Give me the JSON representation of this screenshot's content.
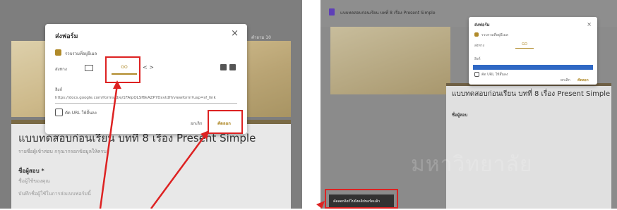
{
  "left": {
    "dialog": {
      "title": "ส่งฟอร์ม",
      "close": "×",
      "collect_emails": "รวบรวมที่อยู่อีเมล",
      "send_via": "ส่งทาง",
      "link_tab": "GO",
      "embed_tab": "< >",
      "link_label": "ลิงก์",
      "url": "https://docs.google.com/forms/d/e/1FAIpQLSf6kAZP7DxvtdH/viewform?usp=sf_link",
      "shorten_url": "ตัด URL ให้สั้นลง",
      "cancel": "ยกเลิก",
      "copy": "คัดลอก"
    },
    "form": {
      "title": "แบบทดสอบก่อนเรียน บทที่ 8 เรื่อง Present Simple",
      "subtitle": "รายชื่อผู้เข้าสอบ กรุณากรอกข้อมูลให้ครบ",
      "field_label": "ชื่อผู้สอบ *",
      "field_hint": "ชื่อผู้ใช้ของคุณ",
      "field_hint2": "บันทึกชื่อผู้ใช้ในการส่งแบบฟอร์มนี้",
      "side_label": "คำถาม 10"
    }
  },
  "right": {
    "doc_title": "แบบทดสอบก่อนเรียน บทที่ 8 เรื่อง Present Simple",
    "dialog": {
      "title": "ส่งฟอร์ม",
      "collect_emails": "รวบรวมที่อยู่อีเมล",
      "send_via": "ส่งทาง",
      "link_tab": "GO",
      "link_label": "ลิงก์",
      "shorten_url": "ตัด URL ให้สั้นลง",
      "cancel": "ยกเลิก",
      "copy": "คัดลอก"
    },
    "form_title": "แบบทดสอบก่อนเรียน บทที่ 8 เรื่อง Present Simple",
    "field_label": "ชื่อผู้สอบ",
    "toast": "คัดลอกลิงก์ไปยังคลิปบอร์ดแล้ว",
    "watermark": "มหาวิทยาลัย"
  },
  "colors": {
    "accent": "#b08a2a",
    "highlight": "#d22222",
    "selection": "#2f68c4"
  }
}
